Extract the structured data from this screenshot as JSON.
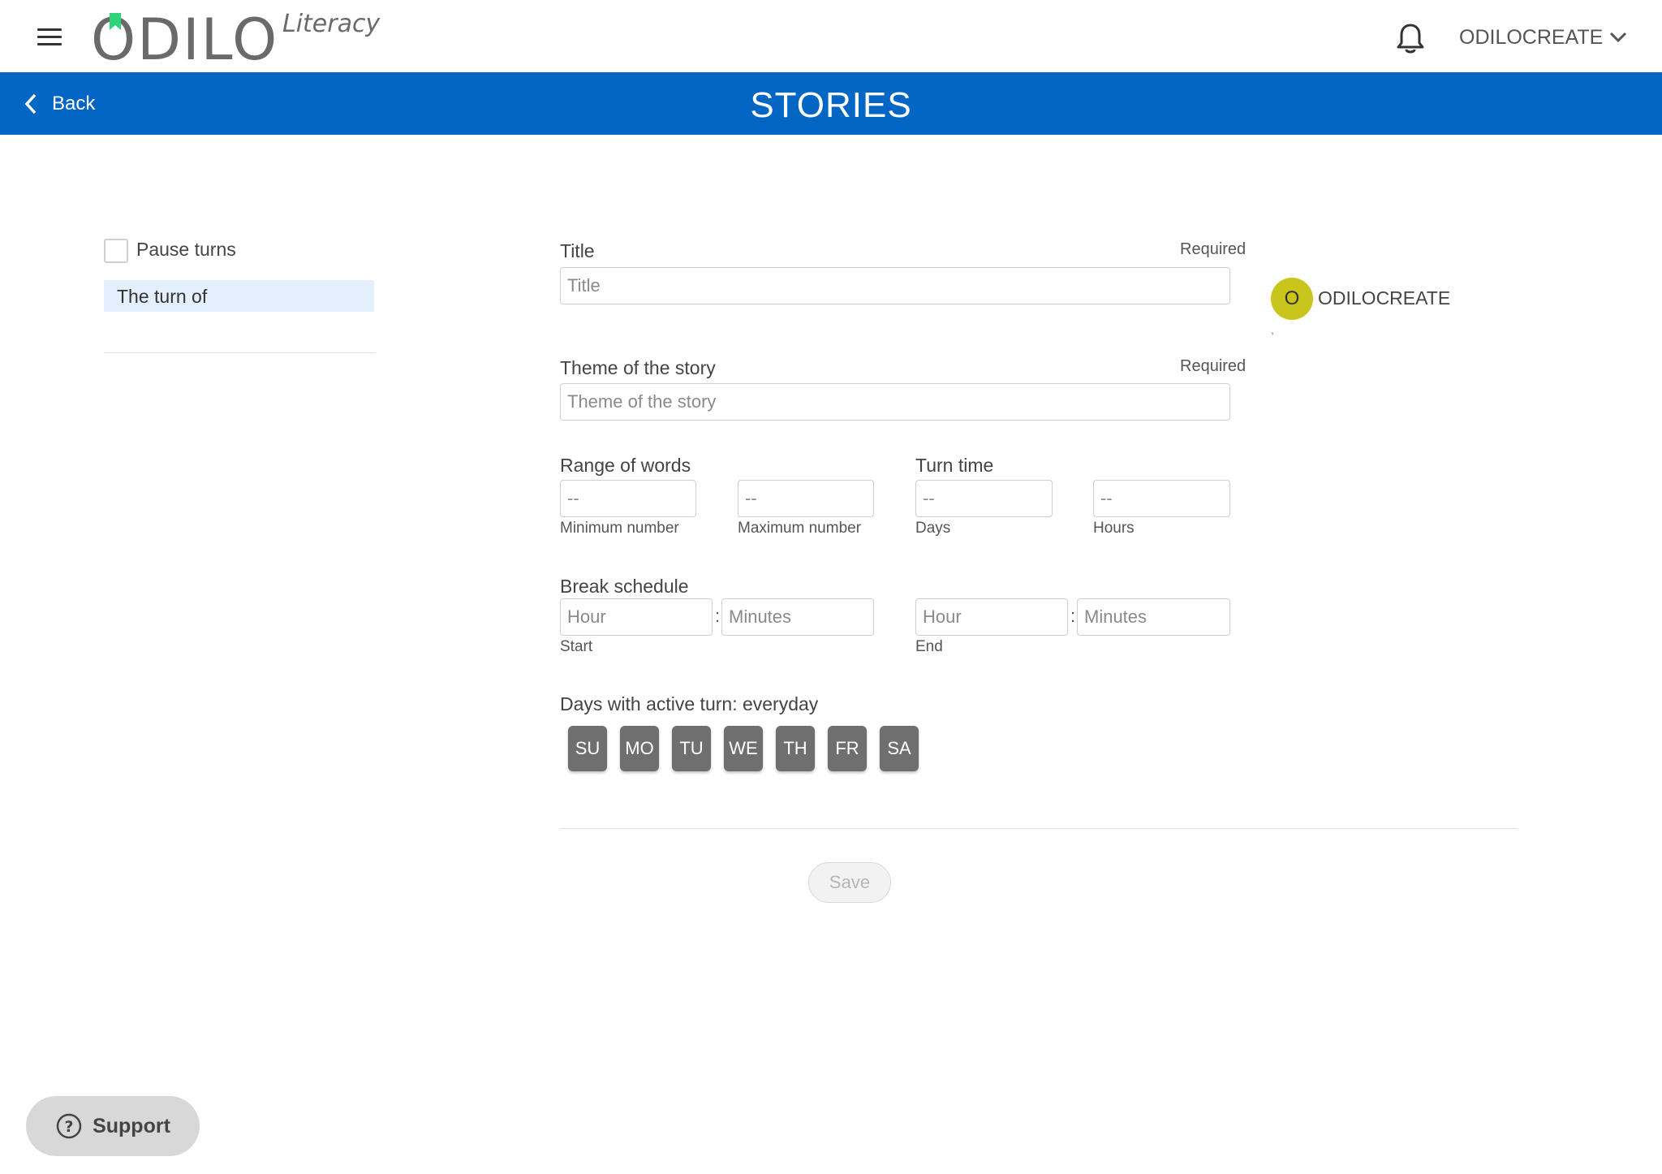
{
  "header": {
    "logo_main": "ODILO",
    "logo_sub": "Literacy",
    "user_menu_label": "ODILOCREATE",
    "icons": {
      "menu": "hamburger-icon",
      "bell": "bell-icon",
      "chevron": "chevron-down-icon"
    }
  },
  "titlebar": {
    "back_label": "Back",
    "title": "STORIES",
    "background": "#0366c5"
  },
  "sidebar": {
    "pause_turns_label": "Pause turns",
    "pause_turns_checked": false,
    "turn_of_label": "The turn of"
  },
  "form": {
    "title": {
      "label": "Title",
      "required": "Required",
      "placeholder": "Title"
    },
    "theme": {
      "label": "Theme of the story",
      "required": "Required",
      "placeholder": "Theme of the story"
    },
    "range_of_words": {
      "label": "Range of words",
      "min": {
        "value": "--",
        "caption": "Minimum number"
      },
      "max": {
        "value": "--",
        "caption": "Maximum number"
      }
    },
    "turn_time": {
      "label": "Turn time",
      "days": {
        "value": "--",
        "caption": "Days"
      },
      "hours": {
        "value": "--",
        "caption": "Hours"
      }
    },
    "break_schedule": {
      "label": "Break schedule",
      "colon": ":",
      "start": {
        "hour_placeholder": "Hour",
        "minutes_placeholder": "Minutes",
        "caption": "Start"
      },
      "end": {
        "hour_placeholder": "Hour",
        "minutes_placeholder": "Minutes",
        "caption": "End"
      }
    },
    "active_days": {
      "label": "Days with active turn: everyday",
      "days": [
        "SU",
        "MO",
        "TU",
        "WE",
        "TH",
        "FR",
        "SA"
      ]
    },
    "save_label": "Save"
  },
  "author": {
    "initial": "O",
    "name": "ODILOCREATE",
    "trailing": ",",
    "avatar_color": "#c9c51a"
  },
  "support": {
    "label": "Support",
    "icon": "help-circle-icon"
  }
}
